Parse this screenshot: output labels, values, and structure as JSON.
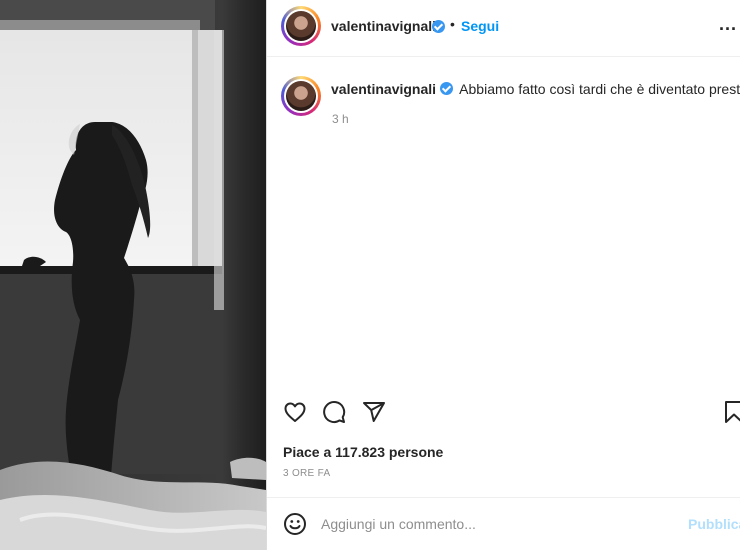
{
  "post": {
    "username": "valentinavignali",
    "follow_label": "Segui",
    "separator": "•",
    "more_label": "...",
    "caption": "Abbiamo fatto così tardi che è diventato presto",
    "caption_time": "3 h",
    "likes": "Piace a 117.823 persone",
    "date": "3 ORE FA"
  },
  "comment": {
    "placeholder": "Aggiungi un commento...",
    "publish_label": "Pubblica"
  },
  "icons": {
    "like": "heart-icon",
    "comment": "comment-icon",
    "share": "send-icon",
    "save": "bookmark-icon",
    "emoji": "smiley-icon",
    "verified": "verified-badge-icon",
    "more": "more-dots-icon"
  },
  "colors": {
    "accent": "#0095f6",
    "verified": "#3897f0",
    "publish_disabled": "#b2dffc",
    "muted": "#8e8e8e"
  }
}
